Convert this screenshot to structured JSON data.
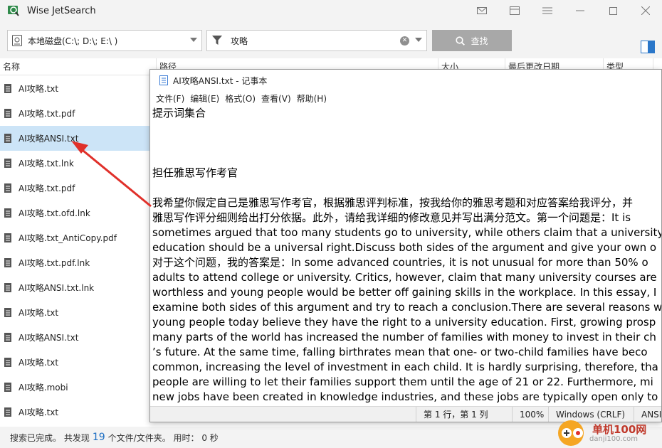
{
  "app": {
    "title": "Wise JetSearch"
  },
  "toolbar": {
    "drive_value": "本地磁盘(C:\\; D:\\; E:\\ )",
    "search_value": "攻略",
    "search_button_label": "查找"
  },
  "columns": [
    "名称",
    "路径",
    "大小",
    "最后更改日期",
    "类型"
  ],
  "files": [
    {
      "name": "AI攻略.txt"
    },
    {
      "name": "AI攻略.txt.pdf"
    },
    {
      "name": "AI攻略ANSI.txt",
      "selected": true
    },
    {
      "name": "AI攻略.txt.lnk"
    },
    {
      "name": "AI攻略.txt.pdf"
    },
    {
      "name": "AI攻略.txt.ofd.lnk"
    },
    {
      "name": "AI攻略.txt_AntiCopy.pdf"
    },
    {
      "name": "AI攻略.txt.pdf.lnk"
    },
    {
      "name": "AI攻略ANSI.txt.lnk"
    },
    {
      "name": "AI攻略.txt"
    },
    {
      "name": "AI攻略ANSI.txt"
    },
    {
      "name": "AI攻略.txt"
    },
    {
      "name": "AI攻略.mobi"
    },
    {
      "name": "AI攻略.txt"
    }
  ],
  "status": {
    "prefix": "搜索已完成。 共发现",
    "count": "19",
    "suffix": "个文件/文件夹。 用时： 0 秒"
  },
  "notepad": {
    "title": "AI攻略ANSI.txt - 记事本",
    "menu": [
      "文件(F)",
      "编辑(E)",
      "格式(O)",
      "查看(V)",
      "帮助(H)"
    ],
    "lines": [
      "提示词集合",
      "",
      "",
      "",
      "担任雅思写作考官",
      "",
      "我希望你假定自己是雅思写作考官，根据雅思评判标准，按我给你的雅思考题和对应答案给我评分，并",
      "雅思写作评分细则给出打分依据。此外，请给我详细的修改意见并写出满分范文。第一个问题是：It is",
      "sometimes argued that too many students go to university, while others claim that a university",
      "education should be a universal right.Discuss both sides of the argument and give your own o",
      "对于这个问题，我的答案是：In some advanced countries, it is not unusual for more than 50% o",
      "adults to attend college or university. Critics, however, claim that many university courses are",
      "worthless and young people would be better off gaining skills in the workplace. In this essay, I",
      "examine both sides of this argument and try to reach a conclusion.There are several reasons w",
      "young people today believe they have the right to a university education. First, growing prosp",
      "many parts of the world has increased the number of families with money to invest in their ch",
      "’s future. At the same time, falling birthrates mean that one- or two-child families have beco",
      "common, increasing the level of investment in each child. It is hardly surprising, therefore, tha",
      "people are willing to let their families support them until the age of 21 or 22. Furthermore, mi",
      "new jobs have been created in knowledge industries, and these jobs are typically open only to"
    ],
    "status": {
      "position": "第 1 行，第 1 列",
      "zoom": "100%",
      "eol": "Windows (CRLF)",
      "encoding": "ANSI"
    }
  },
  "watermark": {
    "text": "单机100网",
    "sub": "danji100.com"
  },
  "colors": {
    "selected_row": "#cce4f7",
    "accent": "#1e6fc3",
    "arrow": "#e0302a"
  }
}
